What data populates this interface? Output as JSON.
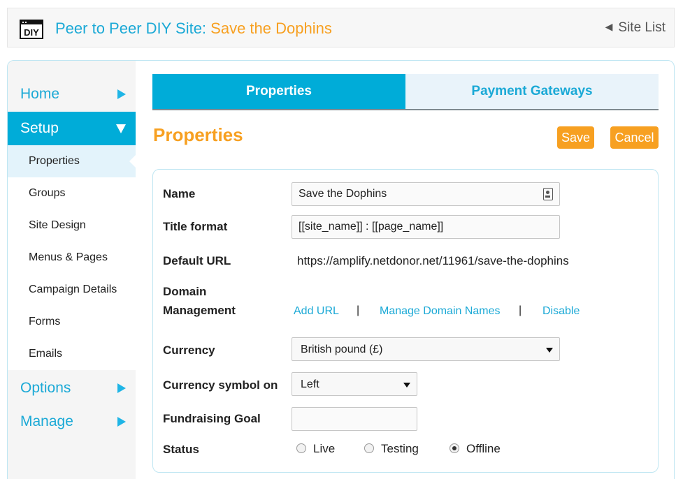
{
  "header": {
    "logo_text": "DIY",
    "title_prefix": "Peer to Peer DIY Site: ",
    "site_name": "Save the Dophins",
    "site_list": "Site List",
    "site_list_icon": "back-arrow-icon"
  },
  "sidebar": {
    "home": "Home",
    "setup": "Setup",
    "setup_items": [
      "Properties",
      "Groups",
      "Site Design",
      "Menus & Pages",
      "Campaign Details",
      "Forms",
      "Emails"
    ],
    "options": "Options",
    "manage": "Manage"
  },
  "tabs": {
    "properties": "Properties",
    "payment_gateways": "Payment Gateways"
  },
  "main": {
    "title": "Properties",
    "save": "Save",
    "cancel": "Cancel"
  },
  "form": {
    "name_label": "Name",
    "name_value": "Save the Dophins",
    "title_format_label": "Title format",
    "title_format_value": "[[site_name]] : [[page_name]]",
    "default_url_label": "Default URL",
    "default_url_value": "https://amplify.netdonor.net/11961/save-the-dophins",
    "domain_label_1": "Domain",
    "domain_label_2": "Management",
    "add_url": "Add URL",
    "manage_domains": "Manage Domain Names",
    "disable": "Disable",
    "separator": "|",
    "currency_label": "Currency",
    "currency_value": "British pound (£)",
    "currency_symbol_label": "Currency symbol on",
    "currency_symbol_value": "Left",
    "goal_label": "Fundraising Goal",
    "goal_value": "",
    "status_label": "Status",
    "status_options": [
      "Live",
      "Testing",
      "Offline"
    ],
    "status_selected": "Offline"
  },
  "colors": {
    "accent_blue": "#00acd8",
    "accent_orange": "#f7a021"
  }
}
